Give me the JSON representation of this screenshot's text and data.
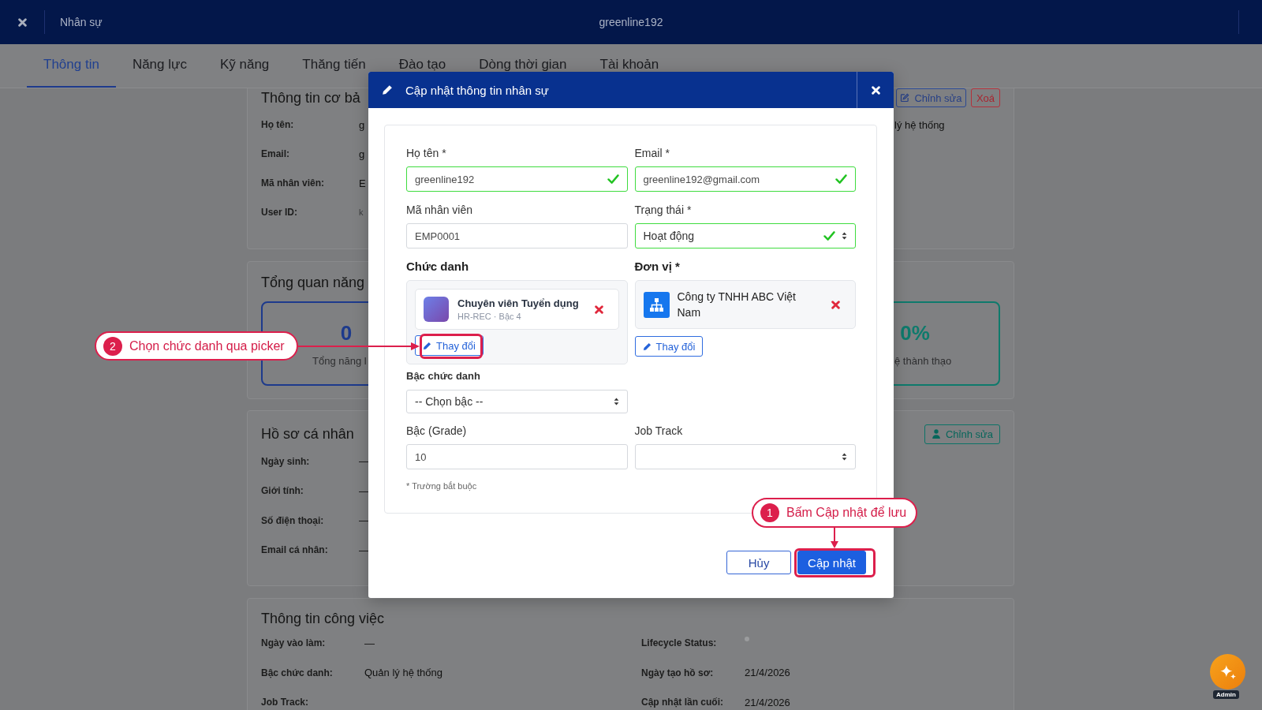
{
  "top_bar": {
    "title": "Nhân sự",
    "user": "greenline192"
  },
  "tabs": [
    {
      "label": "Thông tin",
      "selected": true
    },
    {
      "label": "Năng lực",
      "selected": false
    },
    {
      "label": "Kỹ năng",
      "selected": false
    },
    {
      "label": "Thăng tiến",
      "selected": false
    },
    {
      "label": "Đào tạo",
      "selected": false
    },
    {
      "label": "Dòng thời gian",
      "selected": false
    },
    {
      "label": "Tài khoản",
      "selected": false
    }
  ],
  "basic_info": {
    "title": "Thông tin cơ bả",
    "buttons": [
      {
        "label": "Chỉnh sửa",
        "kind": "edit"
      },
      {
        "label": "Xoá",
        "kind": "delete"
      }
    ],
    "fields": [
      {
        "label": "Họ tên:",
        "value": "g",
        "kind": "text"
      },
      {
        "label": "Email:",
        "value": "g",
        "kind": "text"
      },
      {
        "label": "Mã nhân viên:",
        "value": "E",
        "kind": "text"
      },
      {
        "label": "User ID:",
        "value": "k",
        "kind": "id"
      }
    ],
    "right_values": [
      "lý hệ thống"
    ]
  },
  "competency_overview": {
    "title": "Tổng quan năng",
    "stats": [
      {
        "value": "0",
        "label": "Tổng năng l",
        "kind": "count"
      },
      {
        "value": "0%",
        "label": "ệ thành thạo",
        "kind": "percent"
      }
    ]
  },
  "personal_profile": {
    "title": "Hồ sơ cá nhân",
    "buttons": [
      {
        "label": "Chỉnh sửa",
        "kind": "person"
      }
    ],
    "fields": [
      {
        "label": "Ngày sinh:",
        "value": "—"
      },
      {
        "label": "Giới tính:",
        "value": "—"
      },
      {
        "label": "Số điện thoại:",
        "value": "—"
      },
      {
        "label": "Email cá nhân:",
        "value": "—"
      }
    ]
  },
  "job_info": {
    "title": "Thông tin công việc",
    "left_fields": [
      {
        "label": "Ngày vào làm:",
        "value": "—"
      },
      {
        "label": "Bậc chức danh:",
        "value": "Quản lý hệ thống"
      },
      {
        "label": "Job Track:"
      }
    ],
    "right_fields": [
      {
        "label": "Lifecycle Status:",
        "kind": "status_dot"
      },
      {
        "label": "Ngày tạo hồ sơ:",
        "value": "21/4/2026",
        "kind": "text"
      },
      {
        "label": "Cập nhật lần cuối:",
        "value": "21/4/2026",
        "kind": "text"
      }
    ]
  },
  "modal": {
    "title": "Cập nhật thông tin nhân sự",
    "fields": [
      {
        "label": "Họ tên *",
        "kind": "text",
        "value": "greenline192",
        "valid": true
      },
      {
        "label": "Email *",
        "kind": "text",
        "value": "greenline192@gmail.com",
        "valid": true
      },
      {
        "label": "Mã nhân viên",
        "kind": "text",
        "value": "EMP0001",
        "valid": false
      },
      {
        "label": "Trạng thái *",
        "kind": "select",
        "value": "Hoạt động",
        "valid": true
      }
    ],
    "position": {
      "label": "Chức danh",
      "name": "Chuyên viên Tuyển dụng",
      "meta": "HR-REC · Bậc 4",
      "button": "Thay đổi"
    },
    "unit": {
      "label": "Đơn vị *",
      "name": "Công ty TNHH ABC Việt Nam",
      "button": "Thay đổi"
    },
    "level_field": {
      "label": "Bậc chức danh",
      "kind": "select",
      "value": "-- Chọn bậc --"
    },
    "grade_fields": [
      {
        "label": "Bậc (Grade)",
        "kind": "text",
        "value": "10"
      },
      {
        "label": "Job Track",
        "kind": "select"
      }
    ],
    "note": "* Trường bắt buộc",
    "buttons": [
      {
        "label": "Hủy",
        "kind": "secondary"
      },
      {
        "label": "Cập nhật",
        "kind": "primary"
      }
    ]
  },
  "annotations": [
    {
      "number": "1",
      "text": "Bấm Cập nhật để lưu",
      "kind": "arrow_down"
    },
    {
      "number": "2",
      "text": "Chọn chức danh qua picker",
      "kind": "arrow_right"
    }
  ],
  "assistant": {
    "badge": "Admin"
  }
}
